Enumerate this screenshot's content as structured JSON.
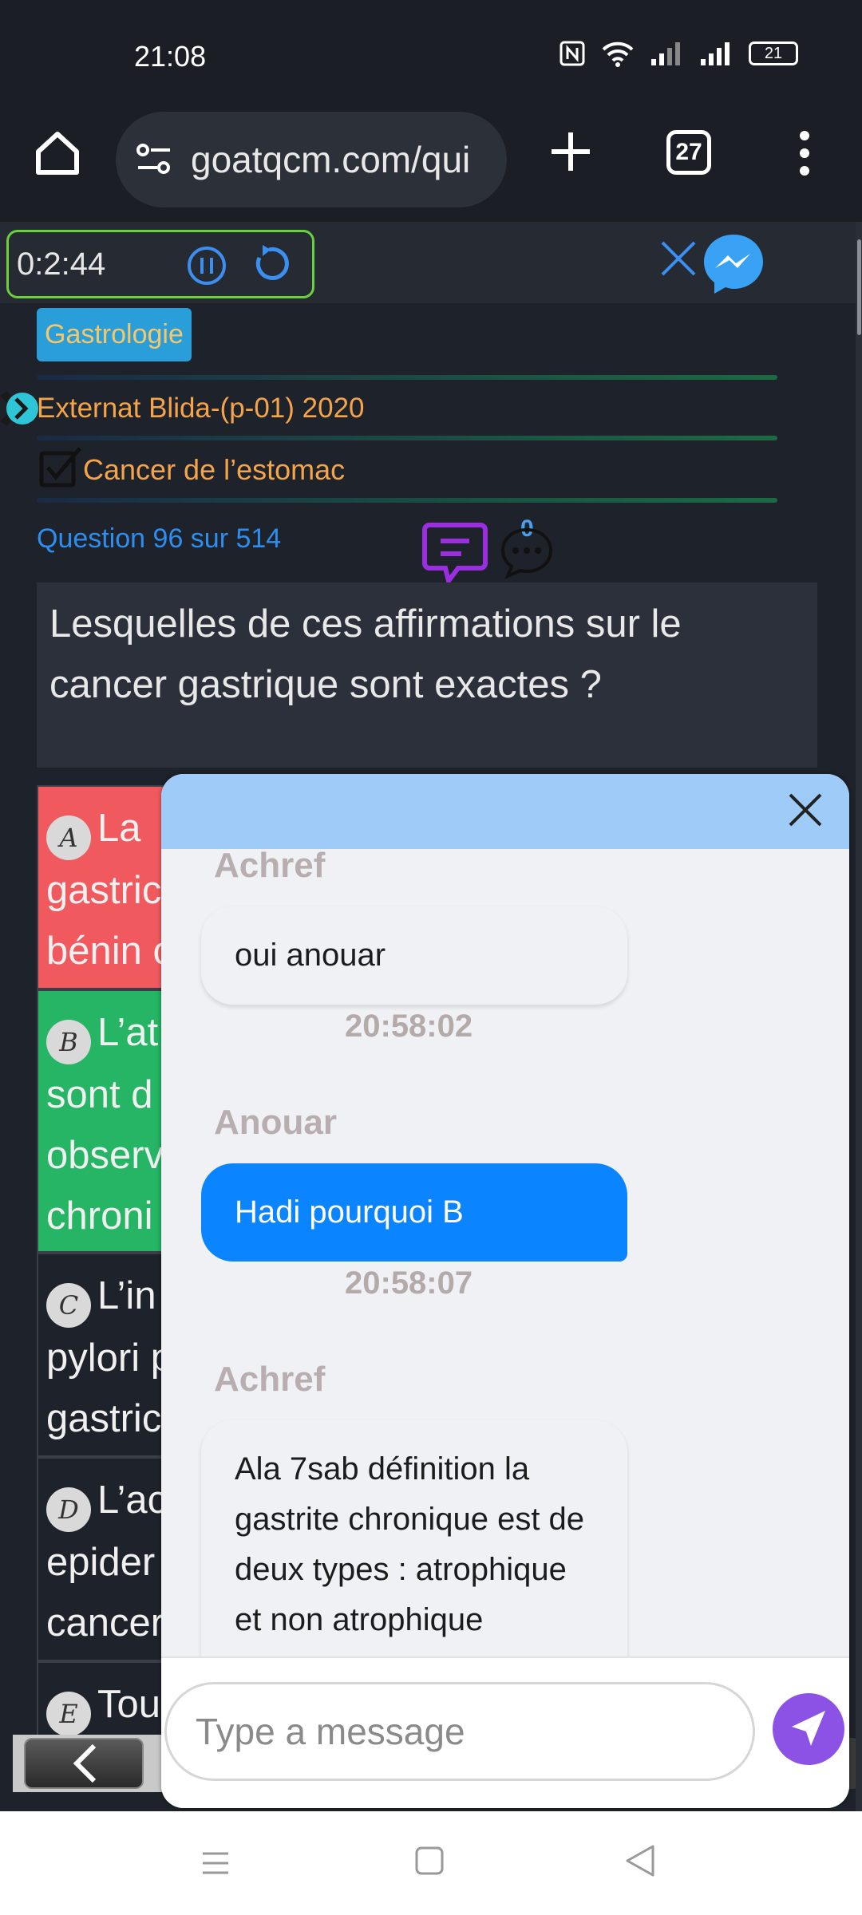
{
  "status_bar": {
    "time": "21:08",
    "battery": "21"
  },
  "browser": {
    "url": "goatqcm.com/qui",
    "tab_count": "27"
  },
  "quiz": {
    "timer": "0:2:44",
    "subject_tag": "Gastrologie",
    "source": "Externat Blida-(p-01) 2020",
    "topic": "Cancer de l’estomac",
    "question_counter": "Question 96 sur 514",
    "comment_count": "0",
    "question_text": "Lesquelles de ces affirmations sur le cancer gastrique sont exactes ?",
    "answers": [
      {
        "letter": "A",
        "text": "La",
        "text_line2": "gastric",
        "text_line3": "bénin c",
        "state": "incorrect"
      },
      {
        "letter": "B",
        "text": "L’at",
        "text_line2": "sont d",
        "text_line3": "observ",
        "text_line4": "chroni",
        "state": "correct"
      },
      {
        "letter": "C",
        "text": "L’in",
        "text_line2": "pylori p",
        "text_line3": "gastric",
        "state": "neutral"
      },
      {
        "letter": "D",
        "text": "L’ac",
        "text_line2": "epider",
        "text_line3": "cancer",
        "state": "neutral"
      },
      {
        "letter": "E",
        "text": "Tou",
        "state": "neutral"
      }
    ]
  },
  "chat": {
    "messages": [
      {
        "sender": "Achref",
        "text": "oui anouar",
        "time": "20:58:02",
        "mine": false
      },
      {
        "sender": "Anouar",
        "text": "Hadi pourquoi B",
        "time": "20:58:07",
        "mine": true
      },
      {
        "sender": "Achref",
        "text": "Ala 7sab définition la gastrite chronique est de deux types : atrophique et non atrophique",
        "mine": false
      }
    ],
    "input_placeholder": "Type a message"
  },
  "colors": {
    "correct": "#25b565",
    "incorrect": "#f05a5f",
    "accent": "#0a84ff",
    "send": "#8c52e6"
  }
}
